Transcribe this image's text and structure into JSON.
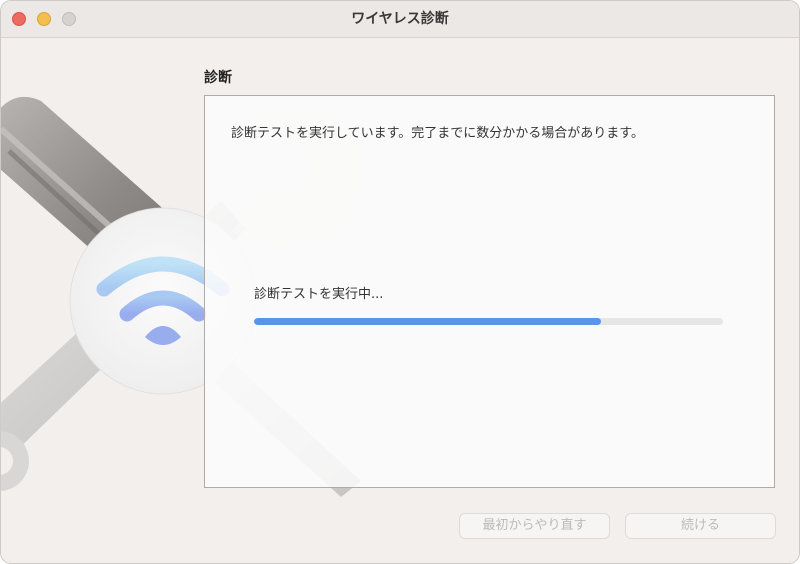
{
  "window": {
    "title": "ワイヤレス診断",
    "traffic_lights": [
      "close",
      "minimize",
      "zoom"
    ]
  },
  "art": {
    "icons": [
      "screwdriver-icon",
      "wrench-icon",
      "wifi-icon"
    ],
    "colors": {
      "wifi_top": "#b8dcf3",
      "wifi_bottom": "#9db3ef",
      "handle": "#8e8a88"
    }
  },
  "main": {
    "section_label": "診断",
    "message": "診断テストを実行しています。完了までに数分かかる場合があります。",
    "progress": {
      "label": "診断テストを実行中...",
      "fraction": 0.74,
      "color": "#5b95ea"
    }
  },
  "buttons": {
    "start_over": "最初からやり直す",
    "continue": "続ける"
  }
}
